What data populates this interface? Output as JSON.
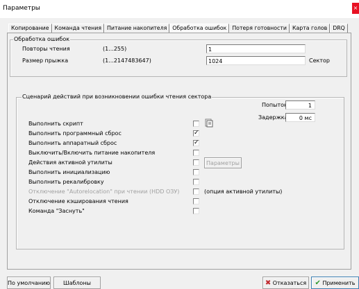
{
  "window": {
    "title": "Параметры",
    "close_icon": "×"
  },
  "tabs": [
    {
      "label": "Копирование"
    },
    {
      "label": "Команда чтения"
    },
    {
      "label": "Питание накопителя"
    },
    {
      "label": "Обработка ошибок",
      "active": true
    },
    {
      "label": "Потеря готовности"
    },
    {
      "label": "Карта голов"
    },
    {
      "label": "DRQ"
    }
  ],
  "error_group": {
    "legend": "Обработка ошибок",
    "retries": {
      "label": "Повторы чтения",
      "range": "(1...255)",
      "value": "1"
    },
    "jump": {
      "label": "Размер прыжка",
      "range": "(1...2147483647)",
      "value": "1024",
      "unit": "Сектор"
    }
  },
  "scenario_group": {
    "legend": "Сценарий действий при возникновении ошибки чтения сектора",
    "attempts": {
      "label": "Попыток",
      "value": "1"
    },
    "delay": {
      "label": "Задержка",
      "value": "0 мс"
    },
    "options": [
      {
        "label": "Выполнить скрипт",
        "checked": false
      },
      {
        "label": "Выполнить программный сброс",
        "checked": true
      },
      {
        "label": "Выполнить аппаратный сброс",
        "checked": true
      },
      {
        "label": "Выключить/Включить питание накопителя",
        "checked": false
      },
      {
        "label": "Действия активной утилиты",
        "checked": false
      },
      {
        "label": "Выполнить инициализацию",
        "checked": false
      },
      {
        "label": "Выполнить рекалибровку",
        "checked": false
      },
      {
        "label": "Отключение \"Autorelocation\" при чтении (HDD ОЗУ)",
        "checked": false,
        "disabled": true
      },
      {
        "label": "Отключение кэширования чтения",
        "checked": false
      },
      {
        "label": "Команда \"Заснуть\"",
        "checked": false
      }
    ],
    "params_button": "Параметры",
    "utility_option_note": "(опция активной утилиты)",
    "check_mark": "✓"
  },
  "footer": {
    "defaults_button": "По умолчанию",
    "templates_button": "Шаблоны",
    "cancel_button": "Отказаться",
    "apply_button": "Применить",
    "cancel_icon": "✖",
    "apply_icon": "✔"
  },
  "colors": {
    "cancel_icon": "#c0282d",
    "apply_icon": "#2f9a2f",
    "close_bg": "#e81123"
  }
}
